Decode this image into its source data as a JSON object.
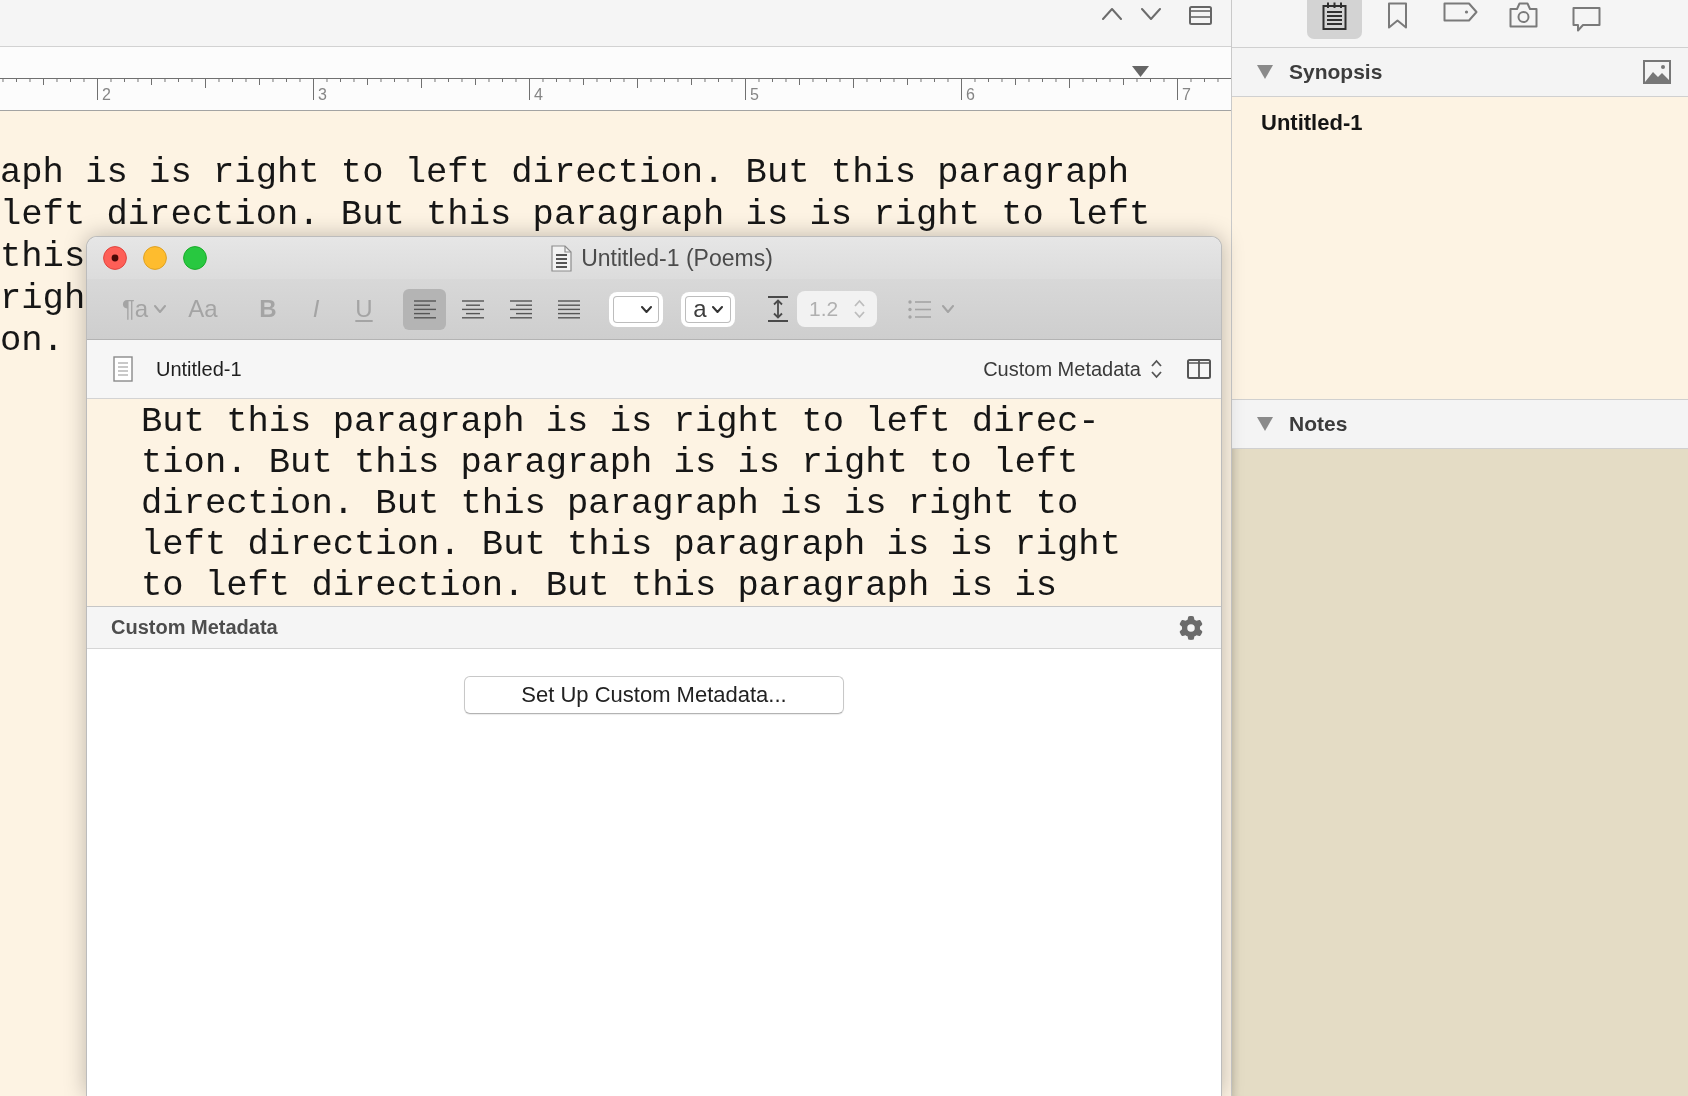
{
  "ruler": {
    "labels": [
      "2",
      "3",
      "4",
      "5",
      "6",
      "7"
    ]
  },
  "editor": {
    "lines": [
      "aph is is right to left direction. But this paragraph",
      "left direction. But this paragraph is is right to left",
      "this",
      "righ",
      "on."
    ]
  },
  "window": {
    "title": "Untitled-1 (Poems)",
    "edited": true,
    "toolbar": {
      "paragraph_style": {
        "label": "¶a",
        "disabled": true
      },
      "fonts": {
        "label": "Aa",
        "disabled": true
      },
      "formats": [
        {
          "kind": "bold",
          "label": "B",
          "disabled": true
        },
        {
          "kind": "italic",
          "label": "I",
          "disabled": true
        },
        {
          "kind": "underline",
          "label": "U",
          "disabled": true
        }
      ],
      "alignments": [
        {
          "kind": "left",
          "selected": true
        },
        {
          "kind": "center",
          "selected": false
        },
        {
          "kind": "right",
          "selected": false
        },
        {
          "kind": "justify",
          "selected": false
        }
      ],
      "letter_dropdown": {
        "label": "a"
      },
      "line_spacing": {
        "value": "1.2",
        "disabled": true
      },
      "list_button": {
        "disabled": true
      }
    },
    "document_header": {
      "title": "Untitled-1",
      "metadata_menu": "Custom Metadata"
    },
    "editor": {
      "lines": [
        "But this paragraph is is right to left direc-",
        "tion. But this paragraph is is right to left",
        "direction. But this paragraph is is right to",
        "left direction. But this paragraph is is right",
        "to left direction. But this paragraph is is"
      ]
    },
    "metadata_pane": {
      "title": "Custom Metadata",
      "button": "Set Up Custom Metadata..."
    }
  },
  "inspector": {
    "tabs": [
      {
        "kind": "notepad",
        "selected": true
      },
      {
        "kind": "bookmark",
        "selected": false
      },
      {
        "kind": "tag",
        "selected": false
      },
      {
        "kind": "camera",
        "selected": false
      },
      {
        "kind": "speech",
        "selected": false
      }
    ],
    "sections": [
      {
        "kind": "synopsis",
        "title": "Synopsis",
        "expanded": true,
        "text": "Untitled-1"
      },
      {
        "kind": "notes",
        "title": "Notes",
        "expanded": true
      }
    ]
  }
}
